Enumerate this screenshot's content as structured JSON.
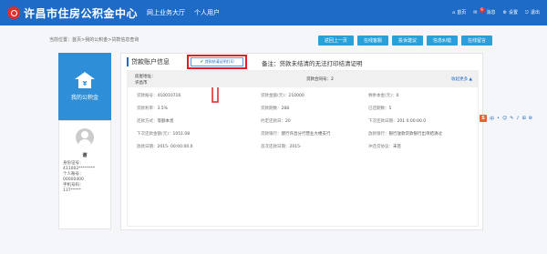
{
  "header": {
    "brand": "许昌市住房公积金中心",
    "nav": [
      "网上业务大厅",
      "个人用户"
    ],
    "top_right": [
      {
        "label": "首页",
        "icon": "home-icon"
      },
      {
        "label": "消息",
        "icon": "message-icon",
        "badge": "9"
      },
      {
        "label": "设置",
        "icon": "gear-icon"
      },
      {
        "label": "退出",
        "icon": "exit-icon"
      }
    ]
  },
  "breadcrumb": "当前位置：首页>我的公积金>贷款信息查询",
  "buttons": [
    "返回上一页",
    "在线客服",
    "投诉建议",
    "信息纠错",
    "在线留言"
  ],
  "left_card": {
    "label": "我的公积金",
    "symbol": "¥"
  },
  "profile": {
    "name": "谢",
    "lines": [
      "身份证号：",
      "411002********",
      "个人账号：",
      "00000400",
      "手机号码：",
      "137*****"
    ]
  },
  "main": {
    "title": "贷款账户信息",
    "print_button": "贷款结清证明打印",
    "note": "备注：贷款未结清的无法打印结清证明",
    "more": "收起更多",
    "address_label": "房屋地址：",
    "address_value": "许昌市",
    "contract_label": "贷款合同号：",
    "contract_value": "2",
    "rows": [
      [
        {
          "l": "贷款账号：",
          "v": "410010716"
        },
        {
          "l": "贷款金额(元)：",
          "v": "210000"
        },
        {
          "l": "剩余本金(元)：",
          "v": "0"
        }
      ],
      [
        {
          "l": "贷款利率：",
          "v": "3.5%"
        },
        {
          "l": "贷款期数：",
          "v": "288"
        },
        {
          "l": "已还期数：",
          "v": "5"
        }
      ],
      [
        {
          "l": "还款方式：",
          "v": "等额本息"
        },
        {
          "l": "约定还款日：",
          "v": "20"
        },
        {
          "l": "下次还款日期：",
          "v": "201    0:00:00.0"
        }
      ],
      [
        {
          "l": "下次还款金额(元)：",
          "v": "1051.08"
        },
        {
          "l": "贷款银行：",
          "v": "建行许昌分行营业大楼支行"
        },
        {
          "l": "放款银行：",
          "v": "银行放款贷款银行出单结清过"
        }
      ],
      [
        {
          "l": "放款日期：",
          "v": "2015-           00:00:00.0"
        },
        {
          "l": "首次还款日期：",
          "v": "2015-"
        },
        {
          "l": "冲还贷协议：",
          "v": "未签"
        }
      ]
    ]
  },
  "float_bar": {
    "logo": "S",
    "items": [
      "中",
      "•",
      "☺",
      "✎",
      "♪",
      "⊞",
      "⚙"
    ]
  },
  "colors": {
    "header": "#1d6bc6",
    "button": "#2aa0d8",
    "highlight": "#e02020",
    "card": "#2e8fd8"
  }
}
